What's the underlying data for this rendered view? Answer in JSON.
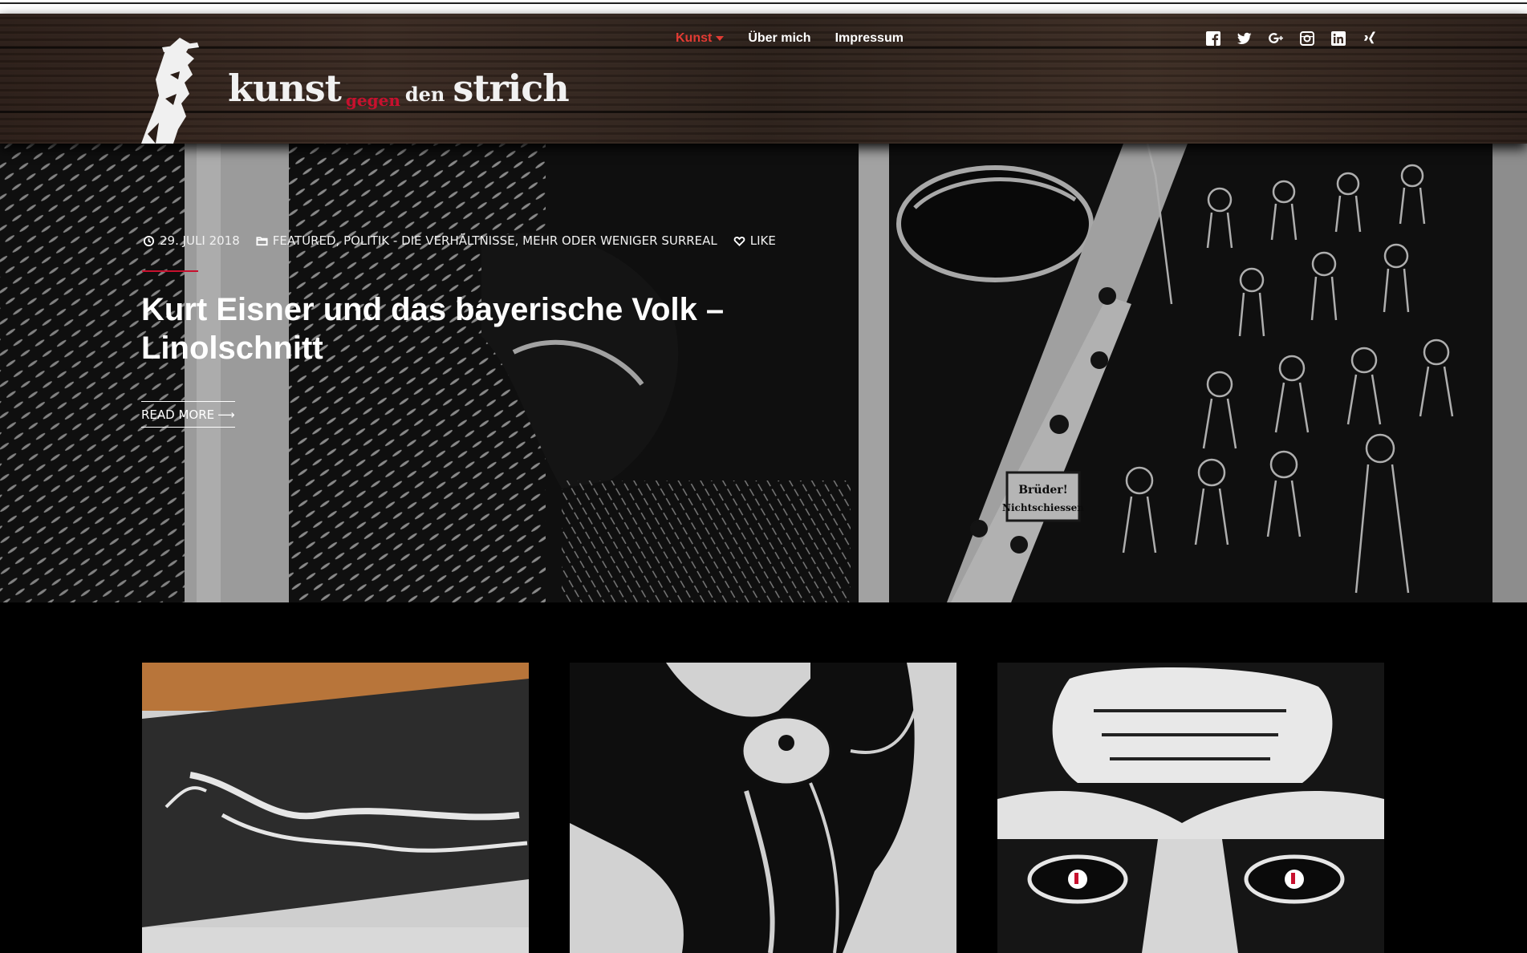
{
  "site": {
    "logo_words": [
      "kunst",
      "gegen",
      "den",
      "strich"
    ]
  },
  "nav": {
    "items": [
      {
        "label": "Kunst",
        "active": true,
        "has_dropdown": true
      },
      {
        "label": "Über mich",
        "active": false,
        "has_dropdown": false
      },
      {
        "label": "Impressum",
        "active": false,
        "has_dropdown": false
      }
    ]
  },
  "social": {
    "icons": [
      "facebook-icon",
      "twitter-icon",
      "google-plus-icon",
      "instagram-icon",
      "linkedin-icon",
      "xing-icon"
    ]
  },
  "hero": {
    "date": "29. JULI 2018",
    "categories": "FEATURED, POLITIK - DIE VERHÄLTNISSE, MEHR ODER WENIGER SURREAL",
    "like_label": "LIKE",
    "title": "Kurt Eisner und das bayerische Volk – Linolschnitt",
    "read_more_label": "READ MORE",
    "banner_text": "Brüder! Nicht schiessen"
  },
  "colors": {
    "accent_red": "#e23b33",
    "logo_red": "#c8102e",
    "background": "#000000"
  },
  "cards": [
    {
      "name": "card-1"
    },
    {
      "name": "card-2"
    },
    {
      "name": "card-3"
    }
  ]
}
